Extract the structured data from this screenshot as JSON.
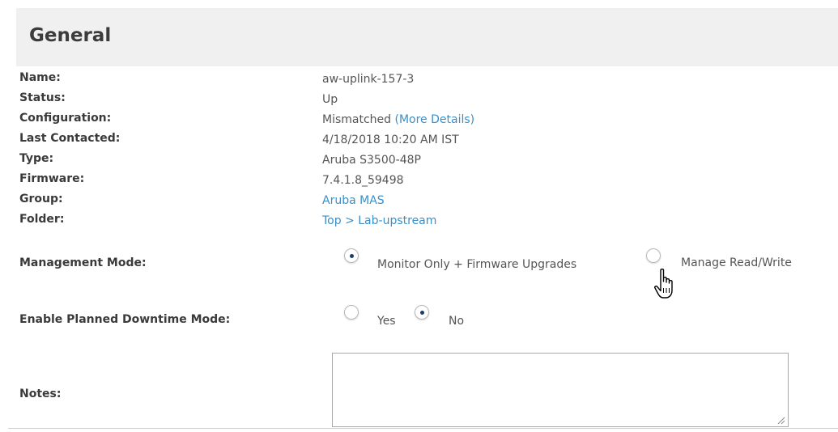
{
  "section": {
    "title": "General"
  },
  "details": {
    "name": {
      "label": "Name:",
      "value": "aw-uplink-157-3"
    },
    "status": {
      "label": "Status:",
      "value": "Up"
    },
    "configuration": {
      "label": "Configuration:",
      "value": "Mismatched",
      "link": "(More Details)"
    },
    "last_contacted": {
      "label": "Last Contacted:",
      "value": "4/18/2018 10:20 AM IST"
    },
    "type": {
      "label": "Type:",
      "value": "Aruba S3500-48P"
    },
    "firmware": {
      "label": "Firmware:",
      "value": "7.4.1.8_59498"
    },
    "group": {
      "label": "Group:",
      "value": "Aruba MAS"
    },
    "folder": {
      "label": "Folder:",
      "value": "Top > Lab-upstream"
    }
  },
  "management_mode": {
    "label": "Management Mode:",
    "options": [
      "Monitor Only + Firmware Upgrades",
      "Manage Read/Write"
    ],
    "selected": "Monitor Only + Firmware Upgrades"
  },
  "planned_downtime": {
    "label": "Enable Planned Downtime Mode:",
    "options": [
      "Yes",
      "No"
    ],
    "selected": "No"
  },
  "notes": {
    "label": "Notes:",
    "value": ""
  },
  "colors": {
    "link": "#3a8fc9",
    "header_bg": "#f0f0f0",
    "radio_dot": "#1a3c6e"
  },
  "icons": {
    "cursor": "hand-pointer-cursor-icon",
    "resize": "resize-grip-icon"
  }
}
